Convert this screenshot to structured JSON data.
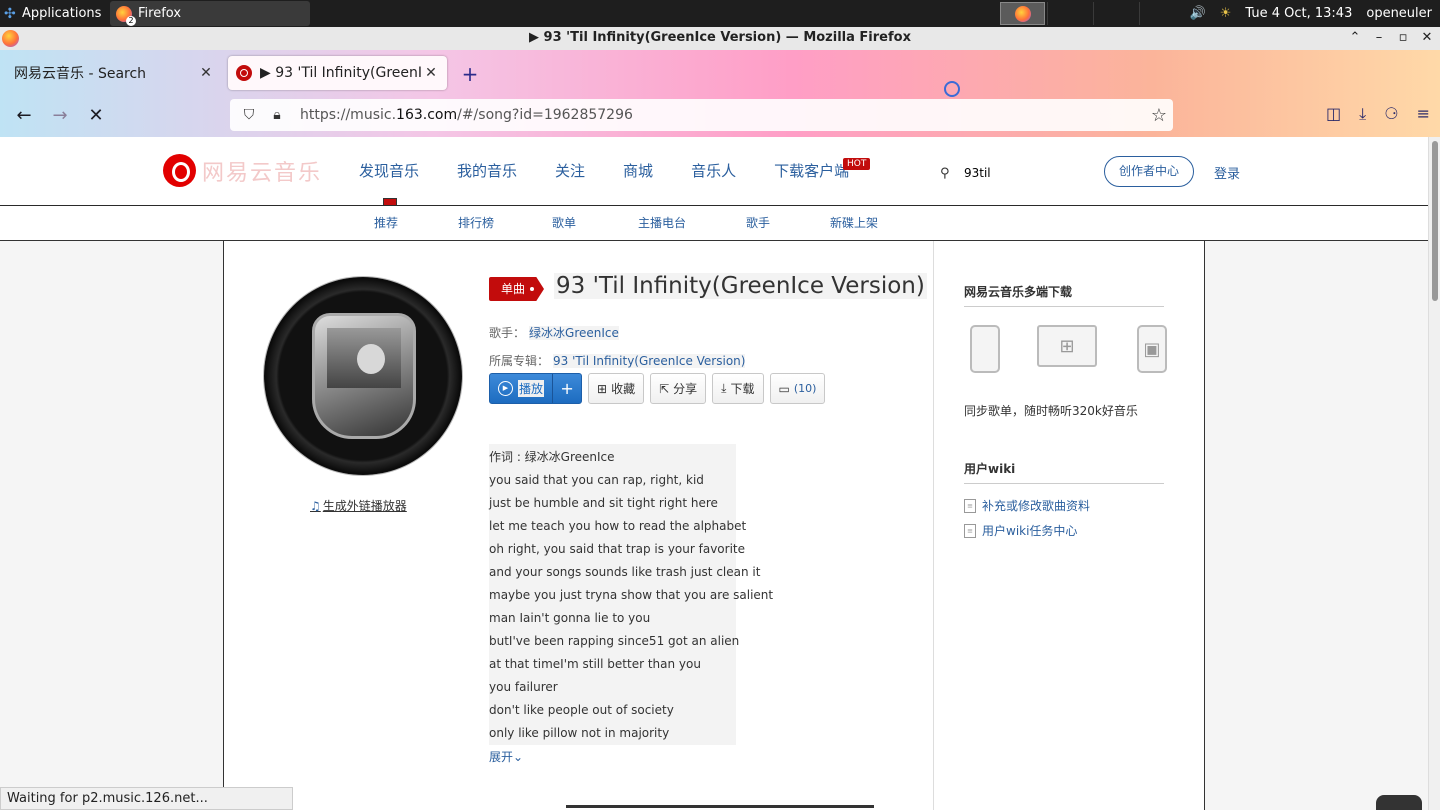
{
  "system": {
    "applications_label": "Applications",
    "task_title": "Firefox",
    "task_count": "2",
    "clock": "Tue  4 Oct, 13:43",
    "user": "openeuler"
  },
  "window": {
    "title": "▶ 93 'Til Infinity(GreenIce Version) — Mozilla Firefox"
  },
  "tabs": [
    {
      "label": "网易云音乐 - Search"
    },
    {
      "label": "▶ 93 'Til Infinity(GreenIce Version)"
    }
  ],
  "urlbar": {
    "prefix": "https://music.",
    "domain": "163.com",
    "suffix": "/#/song?id=1962857296"
  },
  "site": {
    "logo_text": "网易云音乐",
    "main_nav": [
      "发现音乐",
      "我的音乐",
      "关注",
      "商城",
      "音乐人",
      "下载客户端"
    ],
    "hot_badge": "HOT",
    "search_value": "93til",
    "creator_label": "创作者中心",
    "login_label": "登录",
    "sub_nav": [
      "推荐",
      "排行榜",
      "歌单",
      "主播电台",
      "歌手",
      "新碟上架"
    ]
  },
  "song": {
    "badge": "单曲",
    "title": "93 'Til Infinity(GreenIce Version)",
    "artist_label": "歌手：",
    "artist": "绿冰冰GreenIce",
    "album_label": "所属专辑：",
    "album": "93 'Til Infinity(GreenIce Version)",
    "gen_player_link": "生成外链播放器",
    "actions": {
      "play": "播放",
      "add": "+",
      "collect": "收藏",
      "share": "分享",
      "download": "下载",
      "comments": "(10)"
    },
    "lyrics": [
      "作词 : 绿冰冰GreenIce",
      "you said that you can rap, right, kid",
      "just be humble and sit tight right here",
      "let me teach you how to read the alphabet",
      "oh right, you said that trap is your favorite",
      "and your songs sounds like trash just clean it",
      "maybe you just tryna show that you are salient",
      "man Iain't gonna lie to you",
      "butI've been rapping since51 got an alien",
      "at that timeI'm still better than you",
      "you failurer",
      "don't like people out of society",
      "only like pillow not in majority"
    ],
    "expand_label": "展开"
  },
  "sidebar": {
    "download_heading": "网易云音乐多端下载",
    "download_text": "同步歌单，随时畅听320k好音乐",
    "wiki_heading": "用户wiki",
    "wiki_links": [
      "补充或修改歌曲资料",
      "用户wiki任务中心"
    ]
  },
  "status_text": "Waiting for p2.music.126.net...",
  "colors": {
    "brand_red": "#c20c0c",
    "link_blue": "#2b5f9e",
    "play_blue": "#1d6cc0"
  }
}
